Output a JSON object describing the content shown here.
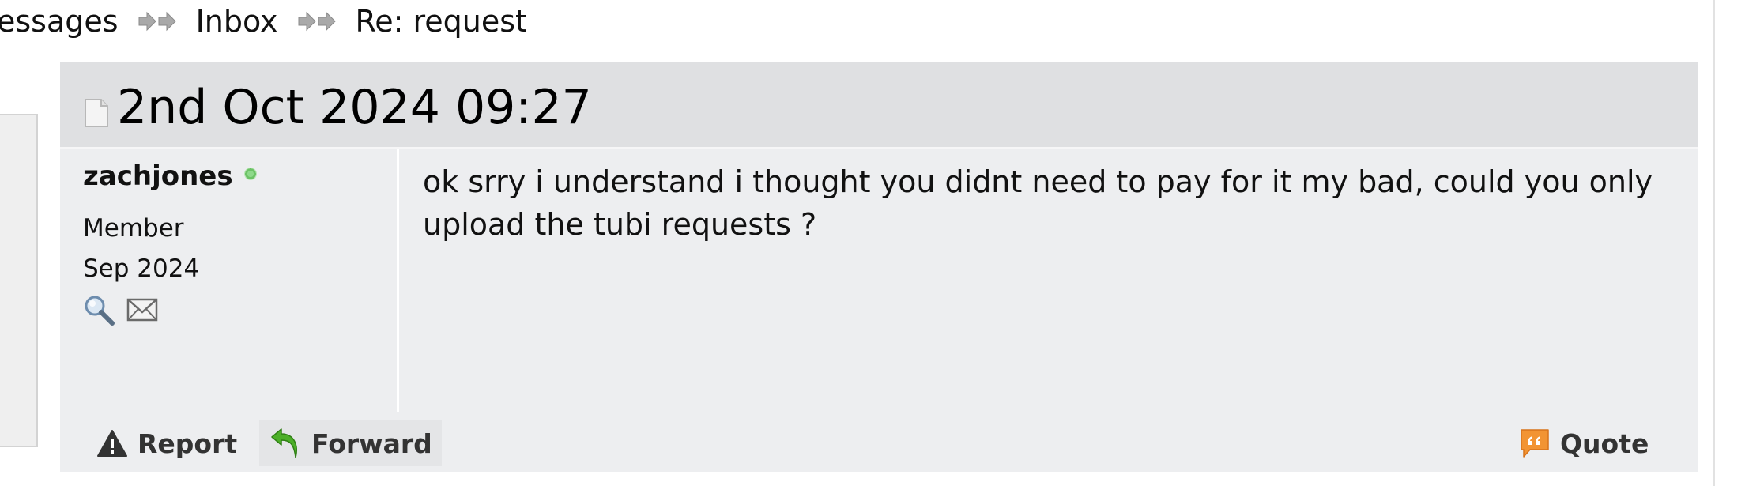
{
  "breadcrumb": {
    "items": [
      "essages",
      "Inbox",
      "Re: request"
    ]
  },
  "message": {
    "date": "2nd Oct 2024 09:27",
    "author": {
      "username": "zachjones",
      "online": true,
      "role": "Member",
      "joined": "Sep 2024"
    },
    "body": "ok srry i understand i thought you didnt need to pay for it my bad, could you only upload the tubi requests ?",
    "actions": {
      "report_label": "Report",
      "forward_label": "Forward",
      "quote_label": "Quote"
    }
  },
  "colors": {
    "header_bg": "#dfe0e2",
    "panel_bg": "#edeef0",
    "online": "#6cc266",
    "forward_icon": "#4caf28",
    "quote_icon": "#f29433"
  },
  "icons": [
    "arrow-separator-icon",
    "document-icon",
    "online-status-icon",
    "search-icon",
    "mail-icon",
    "warning-icon",
    "forward-icon",
    "quote-icon"
  ]
}
